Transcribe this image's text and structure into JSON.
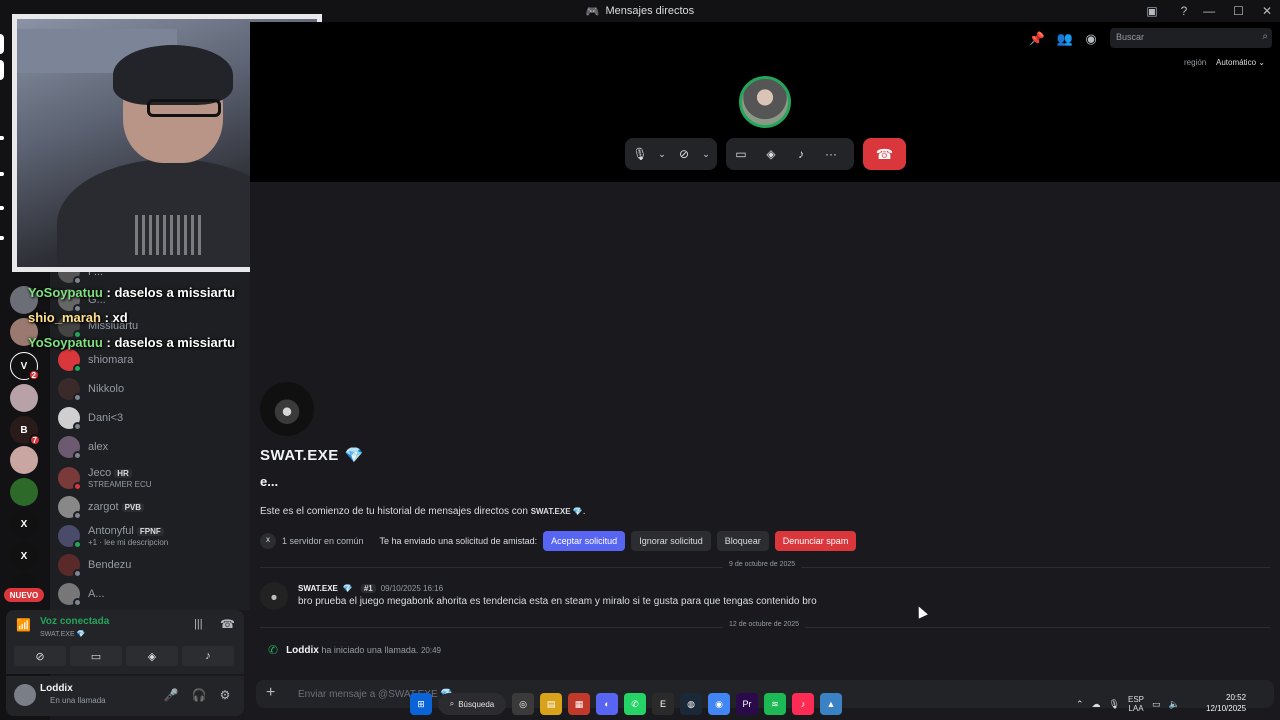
{
  "window": {
    "title": "Mensajes directos",
    "controls": {
      "minimize": "—",
      "maximize": "☐",
      "close": "✕"
    }
  },
  "header": {
    "search_placeholder": "Buscar",
    "region_label": "región",
    "region_value": "Automático"
  },
  "call": {
    "controls": [
      "mic",
      "camera-off",
      "screen-share",
      "activity",
      "soundboard",
      "more"
    ],
    "hangup_icon": "phone-hangup-icon"
  },
  "server_rail": {
    "nuevo_label": "NUEVO",
    "badges": [
      "2",
      "7"
    ]
  },
  "dm_list": {
    "items": [
      {
        "name": "P...",
        "status": "offline"
      },
      {
        "name": "G...",
        "status": "offline"
      },
      {
        "name": "Missiuartu",
        "status": "online"
      },
      {
        "name": "shiomara",
        "status": "online"
      },
      {
        "name": "Nikkolo",
        "status": "offline"
      },
      {
        "name": "Dani<3",
        "status": "offline"
      },
      {
        "name": "alex",
        "status": "offline"
      },
      {
        "name": "Jeco",
        "tag": "HR",
        "sub": "STREAMER ECU",
        "status": "dnd"
      },
      {
        "name": "zargot",
        "tag": "PVB",
        "status": "offline"
      },
      {
        "name": "Antonyful",
        "tag": "FPNF",
        "sub": "+1 · lee mi descripcion",
        "status": "online"
      },
      {
        "name": "Bendezu",
        "status": "offline"
      },
      {
        "name": "A...",
        "status": "offline"
      }
    ]
  },
  "stream_chat": [
    {
      "user": "YoSoypatuu",
      "sep": " : ",
      "text": "daselos a missiartu"
    },
    {
      "user": "shio_marah",
      "sep": " : ",
      "text": "xd"
    },
    {
      "user": "YoSoypatuu",
      "sep": " : ",
      "text": "daselos a missiartu"
    }
  ],
  "voice": {
    "status": "Voz conectada",
    "channel": "SWAT.EXE 💎"
  },
  "user": {
    "name": "Loddix",
    "status": "En una llamada"
  },
  "profile": {
    "username": "SWAT.EXE",
    "gem": "💎",
    "display_name": "e...",
    "intro": "Este es el comienzo de tu historial de mensajes directos con",
    "intro_name": "SWAT.EXE 💎",
    "intro_end": ".",
    "mutual_servers": "1 servidor en común",
    "request_text": "Te ha enviado una solicitud de amistad:",
    "accept": "Aceptar solicitud",
    "ignore": "Ignorar solicitud",
    "block": "Bloquear",
    "report": "Denunciar spam"
  },
  "messages": [
    {
      "date_divider": "9 de octubre de 2025",
      "author": "SWAT.EXE",
      "tag": "#1",
      "timestamp": "09/10/2025 16:16",
      "text": "bro prueba el juego megabonk ahorita es tendencia esta en steam y miralo si te gusta para que tengas contenido bro"
    }
  ],
  "call_event": {
    "date_divider": "12 de octubre de 2025",
    "author": "Loddix",
    "text": "ha iniciado una llamada.",
    "time": "20:49"
  },
  "composer": {
    "placeholder": "Enviar mensaje a @SWAT.EXE 💎"
  },
  "taskbar": {
    "search_label": "Búsqueda",
    "lang_top": "ESP",
    "lang_bottom": "LAA",
    "time": "20:52",
    "date": "12/10/2025"
  },
  "colors": {
    "accent_blue": "#5865f2",
    "danger_red": "#da373c",
    "online_green": "#23a55a"
  }
}
